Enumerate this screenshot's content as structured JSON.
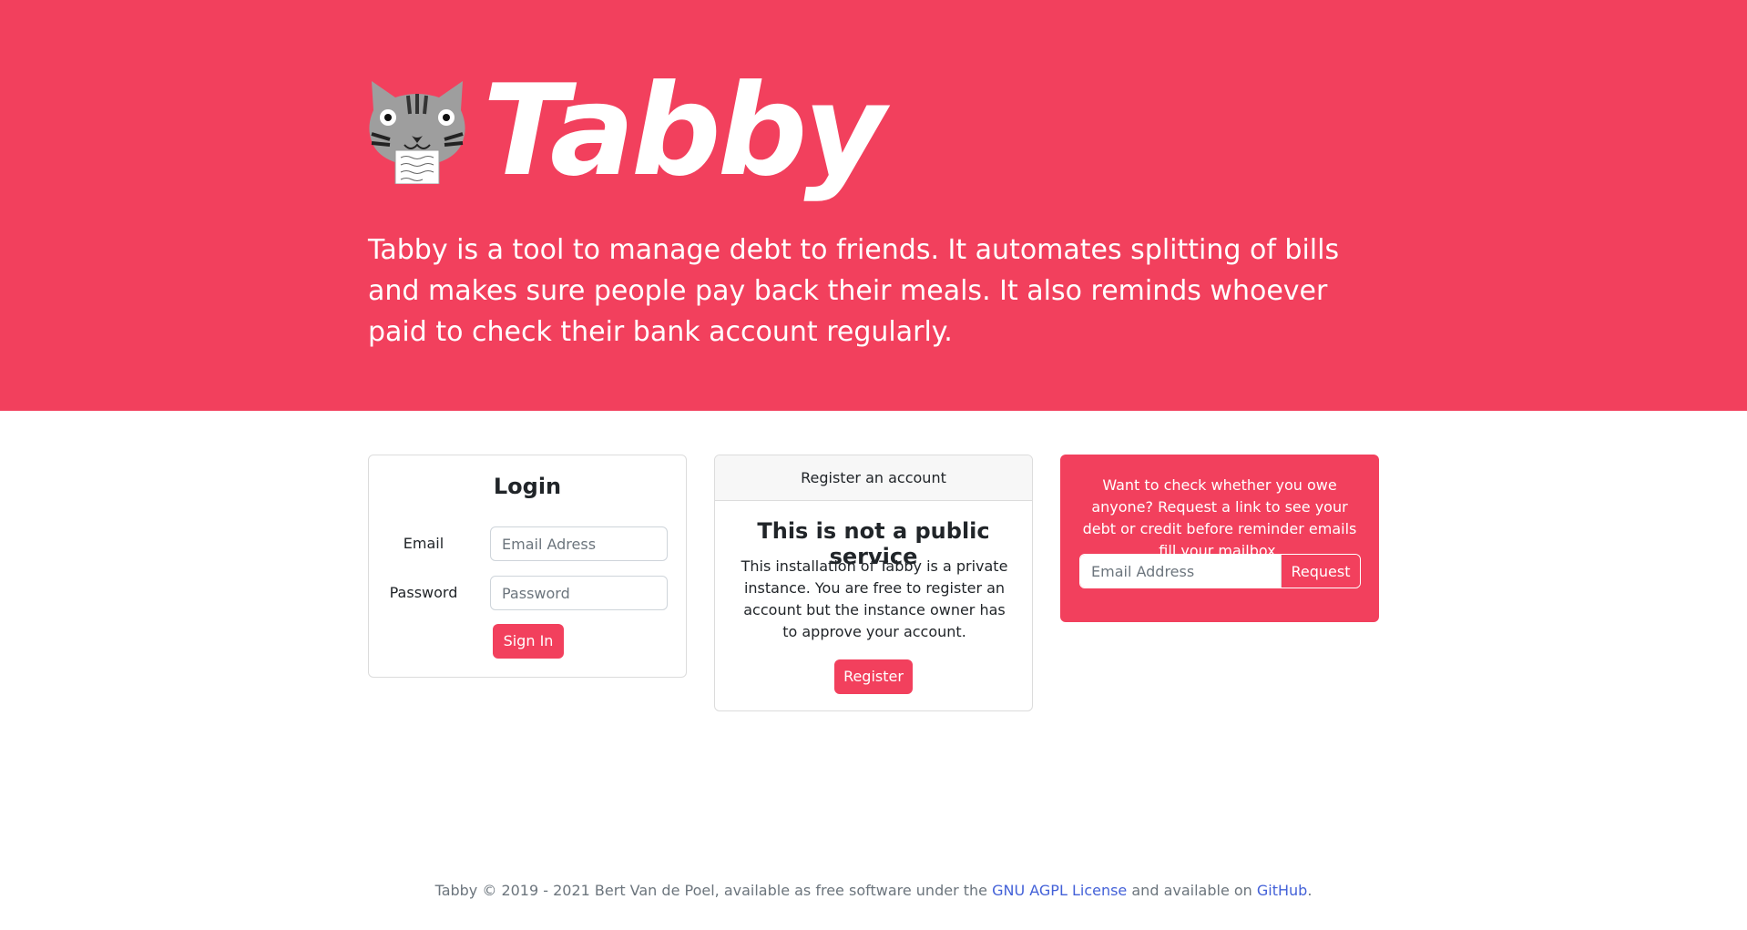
{
  "hero": {
    "brand": "Tabby",
    "tagline": "Tabby is a tool to manage debt to friends. It automates splitting of bills and makes sure people pay back their meals. It also reminds whoever paid to check their bank account regularly.",
    "background_color": "#f2405d"
  },
  "login": {
    "title": "Login",
    "email_label": "Email",
    "email_placeholder": "Email Adress",
    "password_label": "Password",
    "password_placeholder": "Password",
    "submit_label": "Sign In"
  },
  "register": {
    "header": "Register an account",
    "title": "This is not a public service",
    "text": "This installation of Tabby is a private instance. You are free to register an account but the instance owner has to approve your account.",
    "button_label": "Register"
  },
  "request": {
    "text": "Want to check whether you owe anyone? Request a link to see your debt or credit before reminder emails fill your mailbox.",
    "placeholder": "Email Address",
    "button_label": "Request"
  },
  "footer": {
    "prefix": "Tabby © 2019 - 2021 Bert Van de Poel, available as free software under the",
    "license_link": "GNU AGPL License",
    "middle": "and available on",
    "github_link": "GitHub",
    "suffix": ".",
    "link_color": "#4361d8"
  },
  "icons": {
    "logo": "tabby-cat-logo-icon"
  }
}
